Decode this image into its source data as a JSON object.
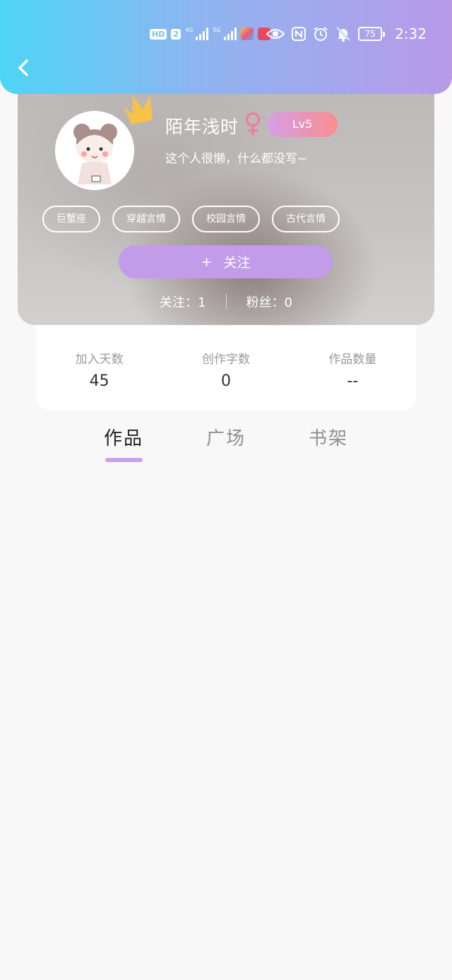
{
  "status_bar": {
    "hd_label": "HD",
    "sim_label": "2",
    "net1_label": "4G",
    "net2_label": "5G",
    "battery": "75",
    "time": "2:32"
  },
  "profile": {
    "username": "陌年浅时",
    "level": "Lv5",
    "bio": "这个人很懒，什么都没写~",
    "tags": [
      "巨蟹座",
      "穿越言情",
      "校园言情",
      "古代言情"
    ],
    "follow_button_plus": "+",
    "follow_button_label": "关注",
    "following_label": "关注：",
    "following_count": "1",
    "fans_label": "粉丝：",
    "fans_count": "0"
  },
  "stats": [
    {
      "label": "加入天数",
      "value": "45"
    },
    {
      "label": "创作字数",
      "value": "0"
    },
    {
      "label": "作品数量",
      "value": "--"
    }
  ],
  "tabs": [
    {
      "label": "作品",
      "active": true
    },
    {
      "label": "广场",
      "active": false
    },
    {
      "label": "书架",
      "active": false
    }
  ],
  "colors": {
    "header_gradient_start": "#4dd5f6",
    "header_gradient_end": "#b89ae9",
    "accent_purple": "#c29be9",
    "level_badge_end": "#f98e8e",
    "female_icon": "#f07a9b",
    "crown": "#f6c248"
  }
}
